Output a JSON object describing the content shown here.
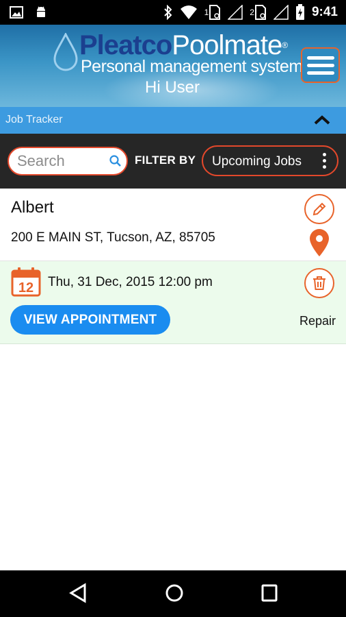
{
  "status_bar": {
    "sim1_label": "1",
    "sim2_label": "2",
    "time": "9:41",
    "icons": [
      "image-icon",
      "android-icon",
      "bluetooth-icon",
      "wifi-icon",
      "signal-icon",
      "battery-icon"
    ]
  },
  "header": {
    "brand_part1": "Pleatco",
    "brand_part2": "Poolmate",
    "brand_mark": "®",
    "tagline": "Personal management system",
    "greeting": "Hi User",
    "menu_icon": "hamburger-menu-icon"
  },
  "section": {
    "title": "Job Tracker",
    "toggle_icon": "chevron-up-icon"
  },
  "filter": {
    "search_placeholder": "Search",
    "filter_label": "FILTER BY",
    "selected_filter": "Upcoming Jobs"
  },
  "jobs": [
    {
      "customer": "Albert",
      "address": "200 E MAIN ST, Tucson, AZ, 85705",
      "calendar_day": "12",
      "datetime": "Thu, 31 Dec, 2015 12:00 pm",
      "action_label": "VIEW APPOINTMENT",
      "job_type": "Repair"
    }
  ],
  "colors": {
    "accent_orange": "#e8632a",
    "button_blue": "#1a8cf0",
    "section_blue": "#3d9be0",
    "filter_bg": "#262626",
    "card_highlight": "#ecfbec"
  }
}
